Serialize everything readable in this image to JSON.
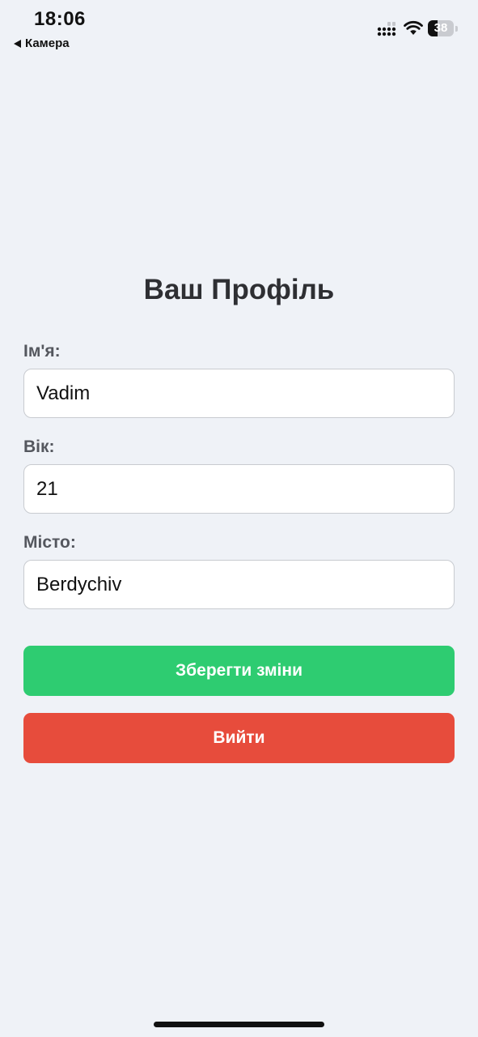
{
  "status_bar": {
    "time": "18:06",
    "back_label": "Камера",
    "battery_level": "38",
    "battery_fraction": 0.38
  },
  "profile": {
    "title": "Ваш Профіль",
    "fields": [
      {
        "label": "Ім'я:",
        "value": "Vadim"
      },
      {
        "label": "Вік:",
        "value": "21"
      },
      {
        "label": "Місто:",
        "value": "Berdychiv"
      }
    ],
    "save_label": "Зберегти зміни",
    "logout_label": "Вийти"
  },
  "colors": {
    "background": "#eff2f7",
    "save_button": "#2ecc71",
    "logout_button": "#e74c3c",
    "title_text": "#2e2f33",
    "label_text": "#54575e"
  },
  "icons": [
    "back-arrow-icon",
    "cellular-signal-icon",
    "wifi-icon",
    "battery-icon"
  ]
}
